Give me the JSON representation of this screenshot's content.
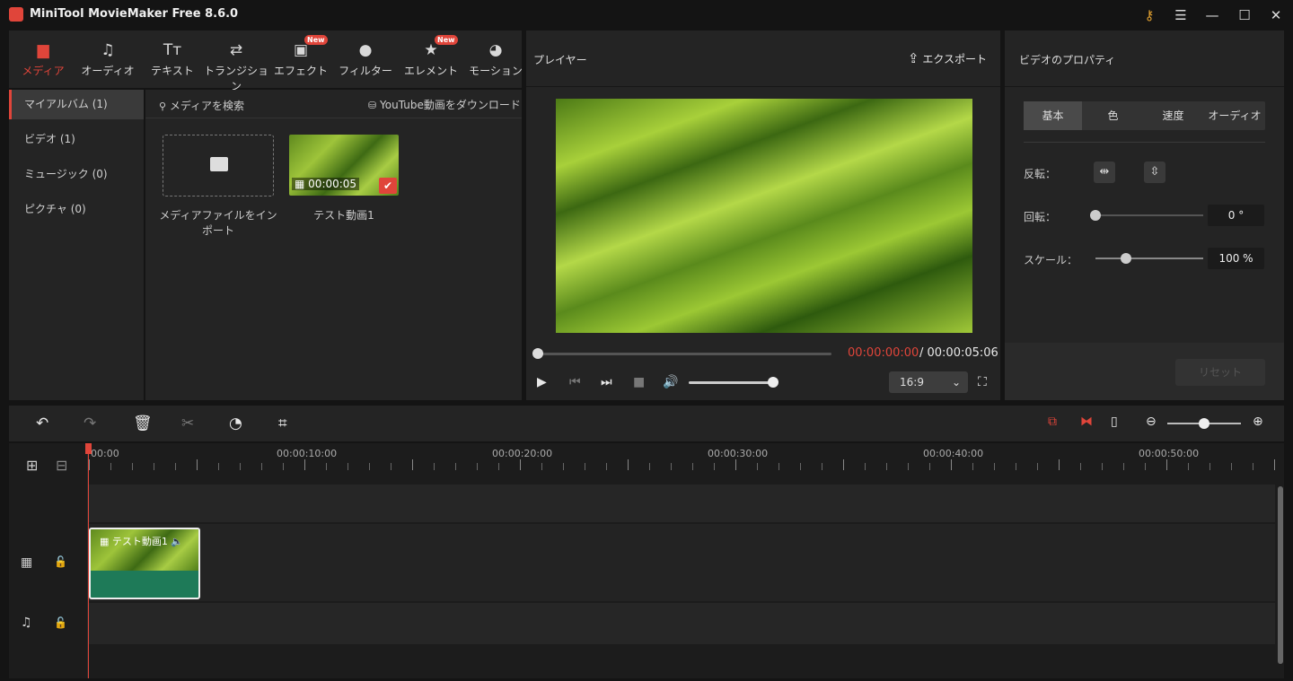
{
  "app": {
    "title": "MiniTool MovieMaker Free 8.6.0"
  },
  "titlebar": {
    "key_icon": "key-icon",
    "menu_icon": "☰",
    "min": "—",
    "max": "☐",
    "close": "✕"
  },
  "toptabs": [
    {
      "label": "メディア",
      "icon": "folder-icon",
      "active": true
    },
    {
      "label": "オーディオ",
      "icon": "music-note-icon"
    },
    {
      "label": "テキスト",
      "icon": "text-icon"
    },
    {
      "label": "トランジション",
      "icon": "swap-arrows-icon"
    },
    {
      "label": "エフェクト",
      "icon": "effect-icon",
      "badge": "New"
    },
    {
      "label": "フィルター",
      "icon": "filter-icon"
    },
    {
      "label": "エレメント",
      "icon": "element-icon",
      "badge": "New"
    },
    {
      "label": "モーション",
      "icon": "motion-icon"
    }
  ],
  "album": [
    {
      "label": "マイアルバム (1)",
      "active": true
    },
    {
      "label": "ビデオ (1)"
    },
    {
      "label": "ミュージック (0)"
    },
    {
      "label": "ピクチャ (0)"
    }
  ],
  "media": {
    "search_label": "メディアを検索",
    "youtube_label": "YouTube動画をダウンロード",
    "import_label": "メディアファイルをインポート",
    "clip_label": "テスト動画1",
    "clip_duration": "00:00:05"
  },
  "player": {
    "title": "プレイヤー",
    "export_label": "エクスポート",
    "time_current": "00:00:00:00",
    "time_total": "/ 00:00:05:06",
    "ratio": "16:9",
    "seek_progress": 0,
    "volume": 1.0
  },
  "props": {
    "title": "ビデオのプロパティ",
    "tabs": [
      "基本",
      "色",
      "速度",
      "オーディオ"
    ],
    "flip_label": "反転：",
    "rotate_label": "回転：",
    "rotate_value": "0 °",
    "scale_label": "スケール：",
    "scale_value": "100 %",
    "rotate_level": 0,
    "scale_level": 0.28,
    "reset_label": "リセット"
  },
  "timeline": {
    "ruler": [
      "00:00",
      "00:00:10:00",
      "00:00:20:00",
      "00:00:30:00",
      "00:00:40:00",
      "00:00:50:00"
    ],
    "clip_label": "テスト動画1",
    "zoom_level": 0.5
  },
  "colors": {
    "accent": "#e0453a",
    "clip": "#1e7a58"
  }
}
